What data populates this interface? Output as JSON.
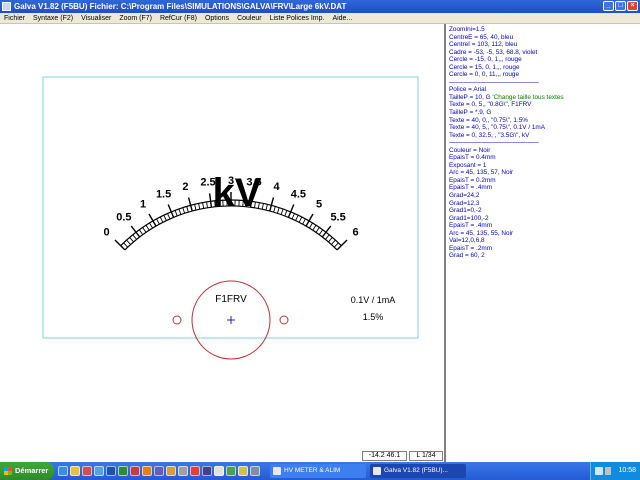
{
  "window": {
    "title": "Galva  V1.82  (F5BU)  Fichier: C:\\Program Files\\SIMULATIONS\\GALVA\\FRV\\Large 6kV.DAT",
    "buttons": {
      "minimize": "_",
      "maximize": "□",
      "close": "×"
    }
  },
  "menu": [
    "Fichier",
    "Syntaxe (F2)",
    "Visualiser",
    "Zoom (F7)",
    "RefCur (F8)",
    "Options",
    "Couleur",
    "Liste Polices Imp.",
    "Aide..."
  ],
  "meter": {
    "unit_label": "kV",
    "model_label": "F1FRV",
    "sensitivity_label": "0.1V / 1mA",
    "accuracy_label": "1.5%",
    "scale_labels": [
      "0",
      "0.5",
      "1",
      "1.5",
      "2",
      "2.5",
      "3",
      "3.5",
      "4",
      "4.5",
      "5",
      "5.5",
      "6"
    ],
    "colors": {
      "frame": "#7fd6d6",
      "circle": "#c03030",
      "center_mark": "#2020c0",
      "scale": "#000000"
    }
  },
  "code_lines": [
    {
      "text": "ZoomIni=1.5"
    },
    {
      "text": "CentreE = 65, 40, bleu"
    },
    {
      "text": "CentreI = 103, 112, bleu"
    },
    {
      "text": "Cadre = -53, -5, 53, 68.8, violet"
    },
    {
      "text": "Cercle = -15, 0, 1,,, rouge"
    },
    {
      "text": "Cercle = 15, 0, 1,,, rouge"
    },
    {
      "text": "Cercle = 0, 0, 11,,, rouge"
    },
    {
      "text": "-------------------------------------------------------",
      "sep": true
    },
    {
      "text": "Police = Arial"
    },
    {
      "text": "TailleP = 10, G",
      "comment": "  'Change taille tous textes"
    },
    {
      "text": "Texte = 0, 5,, \"0.8G\\\", F1FRV"
    },
    {
      "text": "TailleP = *.9, G"
    },
    {
      "text": "Texte = 40, 0,, \"0.75\\\", 1.5%"
    },
    {
      "text": "Texte = 40, 5,, \"0.75\\\", 0.1V / 1mA"
    },
    {
      "text": "Texte = 0, 32.5, , \"3.5G\\\", kV"
    },
    {
      "text": "-------------------------------------------------------",
      "sep": true
    },
    {
      "text": "Couleur = Noir"
    },
    {
      "text": "EpaisT = 0.4mm"
    },
    {
      "text": "Exposant = 1"
    },
    {
      "text": "Arc = 45, 135, 57, Noir"
    },
    {
      "text": "EpaisT = 0.2mm"
    },
    {
      "text": "EpaisT = .4mm"
    },
    {
      "text": "Grad=24,2"
    },
    {
      "text": "Grad=12,3"
    },
    {
      "text": "Grad1=0,-2"
    },
    {
      "text": "Grad1=100,-2"
    },
    {
      "text": "EpaisT = .4mm"
    },
    {
      "text": "Arc = 45, 135, 55, Noir"
    },
    {
      "text": "Val=12,0,6,8"
    },
    {
      "text": "EpaisT = .2mm"
    },
    {
      "text": "Grad = 60,  2"
    }
  ],
  "status": {
    "coords": "-14.2  46.1",
    "line": "L 1/34"
  },
  "taskbar": {
    "start_label": "Démarrer",
    "tasks": [
      {
        "label": "HV METER & ALIM",
        "active": false
      },
      {
        "label": "Galva  V1.82  (F5BU)...",
        "active": true
      }
    ],
    "clock": "10:58"
  }
}
